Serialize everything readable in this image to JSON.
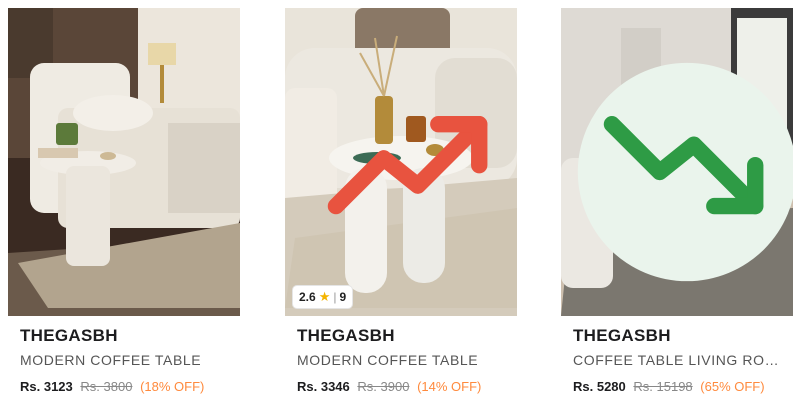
{
  "products": [
    {
      "brand": "THEGASBH",
      "title": "MODERN COFFEE TABLE",
      "price": "Rs. 3123",
      "mrp": "Rs. 3800",
      "discount": "(18% OFF)",
      "image": "white-round-side-table-bedroom"
    },
    {
      "brand": "THEGASBH",
      "title": "MODERN COFFEE TABLE",
      "price": "Rs. 3346",
      "mrp": "Rs. 3900",
      "discount": "(14% OFF)",
      "image": "white-pill-leg-side-table",
      "trend_icon": "trending-up-icon",
      "rating": "2.6",
      "rating_count": "9"
    },
    {
      "brand": "THEGASBH",
      "title": "COFFEE TABLE LIVING ROO...",
      "price": "Rs. 5280",
      "mrp": "Rs. 15198",
      "discount": "(65% OFF)",
      "image": "round-wood-coffee-table-living-room",
      "trend_icon": "trending-down-icon"
    }
  ],
  "colors": {
    "discount": "#ff8a3d",
    "trend_up": "#e8533f",
    "trend_down": "#2e9b45",
    "star": "#f4b400"
  }
}
